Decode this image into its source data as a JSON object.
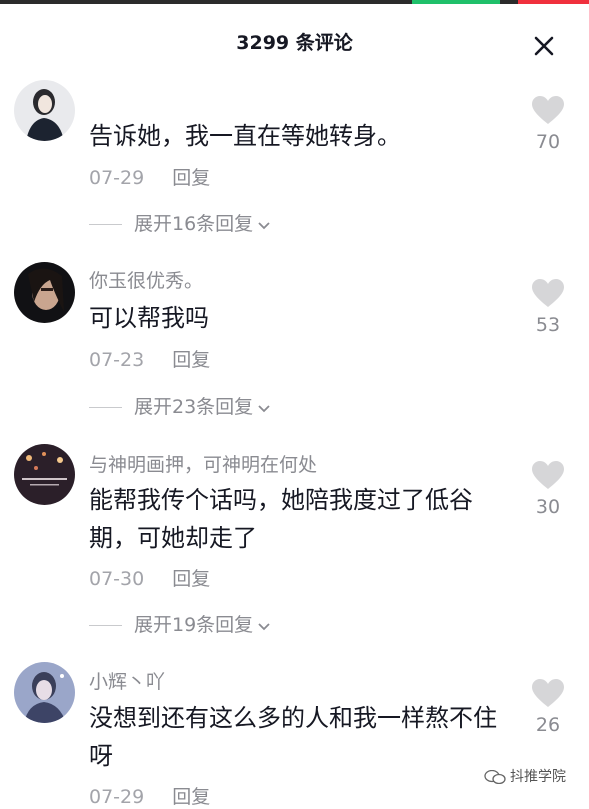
{
  "header": {
    "title": "3299 条评论"
  },
  "comments": [
    {
      "username": "",
      "text": "告诉她，我一直在等她转身。",
      "date": "07-29",
      "reply_label": "回复",
      "expand_label": "展开16条回复",
      "likes": "70"
    },
    {
      "username": "你玉很优秀。",
      "text": "可以帮我吗",
      "date": "07-23",
      "reply_label": "回复",
      "expand_label": "展开23条回复",
      "likes": "53"
    },
    {
      "username": "与神明画押，可神明在何处",
      "text": "能帮我传个话吗，她陪我度过了低谷期，可她却走了",
      "date": "07-30",
      "reply_label": "回复",
      "expand_label": "展开19条回复",
      "likes": "30"
    },
    {
      "username": "小辉丶吖",
      "text": "没想到还有这么多的人和我一样熬不住呀",
      "date": "07-29",
      "reply_label": "回复",
      "likes": "26"
    }
  ],
  "watermark": {
    "text": "抖推学院"
  },
  "colors": {
    "text": "#161823",
    "secondary": "#8a8b91",
    "heart": "#d6d6d8"
  }
}
